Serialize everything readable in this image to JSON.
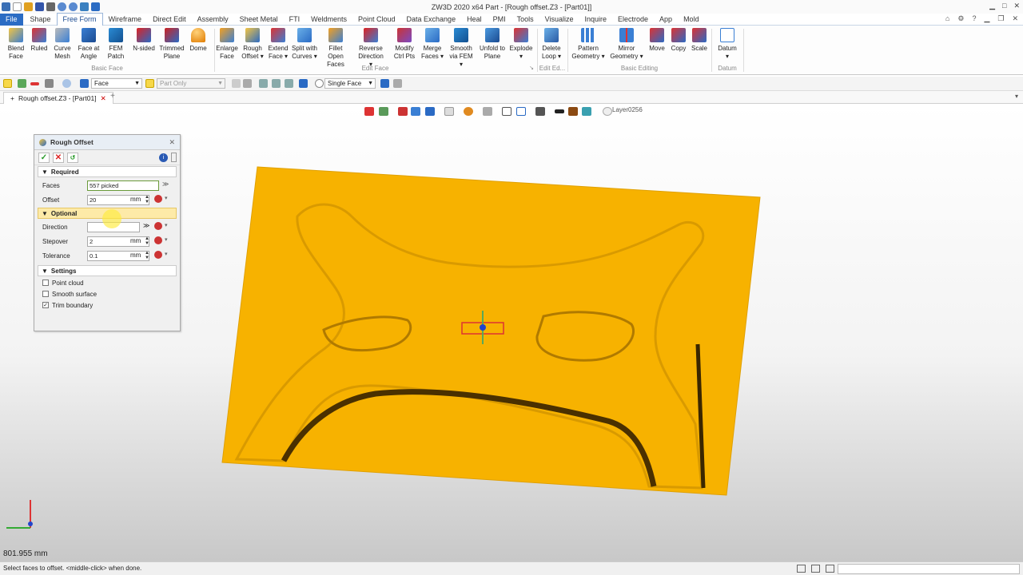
{
  "window": {
    "title": "ZW3D 2020  x64          Part - [Rough offset.Z3 - [Part01]]"
  },
  "menu": {
    "tabs": [
      "File",
      "Shape",
      "Free Form",
      "Wireframe",
      "Direct Edit",
      "Assembly",
      "Sheet Metal",
      "FTI",
      "Weldments",
      "Point Cloud",
      "Data Exchange",
      "Heal",
      "PMI",
      "Tools",
      "Visualize",
      "Inquire",
      "Electrode",
      "App",
      "Mold"
    ],
    "active": "Free Form"
  },
  "ribbon": {
    "buttons": [
      {
        "label": "Blend\nFace",
        "icon": "blend-face-icon"
      },
      {
        "label": "Ruled",
        "icon": "ruled-icon"
      },
      {
        "label": "Curve\nMesh",
        "icon": "curve-mesh-icon"
      },
      {
        "label": "Face at\nAngle",
        "icon": "face-at-angle-icon"
      },
      {
        "label": "FEM\nPatch",
        "icon": "fem-patch-icon"
      },
      {
        "label": "N-sided",
        "icon": "n-sided-icon"
      },
      {
        "label": "Trimmed\nPlane",
        "icon": "trimmed-plane-icon"
      },
      {
        "label": "Dome",
        "icon": "dome-icon"
      },
      {
        "label": "Enlarge\nFace",
        "icon": "enlarge-face-icon"
      },
      {
        "label": "Rough\nOffset ▾",
        "icon": "rough-offset-icon"
      },
      {
        "label": "Extend\nFace ▾",
        "icon": "extend-face-icon"
      },
      {
        "label": "Split with\nCurves ▾",
        "icon": "split-with-curves-icon"
      },
      {
        "label": "Fillet Open\nFaces",
        "icon": "fillet-open-faces-icon"
      },
      {
        "label": "Reverse\nDirection ▾",
        "icon": "reverse-direction-icon"
      },
      {
        "label": "Modify\nCtrl Pts",
        "icon": "modify-ctrl-pts-icon"
      },
      {
        "label": "Merge\nFaces ▾",
        "icon": "merge-faces-icon"
      },
      {
        "label": "Smooth\nvia FEM ▾",
        "icon": "smooth-via-fem-icon"
      },
      {
        "label": "Unfold to\nPlane",
        "icon": "unfold-to-plane-icon"
      },
      {
        "label": "Explode\n▾",
        "icon": "explode-icon"
      },
      {
        "label": "Delete\nLoop ▾",
        "icon": "delete-loop-icon"
      },
      {
        "label": "Pattern\nGeometry ▾",
        "icon": "pattern-geometry-icon"
      },
      {
        "label": "Mirror\nGeometry ▾",
        "icon": "mirror-geometry-icon"
      },
      {
        "label": "Move",
        "icon": "move-icon"
      },
      {
        "label": "Copy",
        "icon": "copy-icon"
      },
      {
        "label": "Scale",
        "icon": "scale-icon"
      },
      {
        "label": "Datum\n▾",
        "icon": "datum-icon"
      }
    ],
    "groups": [
      "Basic Face",
      "Edit Face",
      "Edit Ed...",
      "Basic Editing",
      "Datum"
    ]
  },
  "toolbar2": {
    "filter": "Face",
    "scope": "Part Only",
    "pick_mode": "Single Face"
  },
  "doc_tab": {
    "label": "Rough offset.Z3 - [Part01]"
  },
  "view_toolbar": {
    "layer": "Layer0256"
  },
  "dialog": {
    "title": "Rough Offset",
    "sections": {
      "required": "Required",
      "optional": "Optional",
      "settings": "Settings"
    },
    "fields": {
      "faces": {
        "label": "Faces",
        "value": "557 picked"
      },
      "offset": {
        "label": "Offset",
        "value": "20",
        "unit": "mm"
      },
      "direction": {
        "label": "Direction",
        "value": ""
      },
      "stepover": {
        "label": "Stepover",
        "value": "2",
        "unit": "mm"
      },
      "tolerance": {
        "label": "Tolerance",
        "value": "0.1",
        "unit": "mm"
      }
    },
    "checks": [
      {
        "label": "Point cloud",
        "checked": false
      },
      {
        "label": "Smooth surface",
        "checked": false
      },
      {
        "label": "Trim boundary",
        "checked": true
      }
    ]
  },
  "readout": "801.955 mm",
  "status": "Select faces to offset. <middle-click> when done.",
  "colors": {
    "part": "#f7b200",
    "accent": "#2b6cc4"
  }
}
